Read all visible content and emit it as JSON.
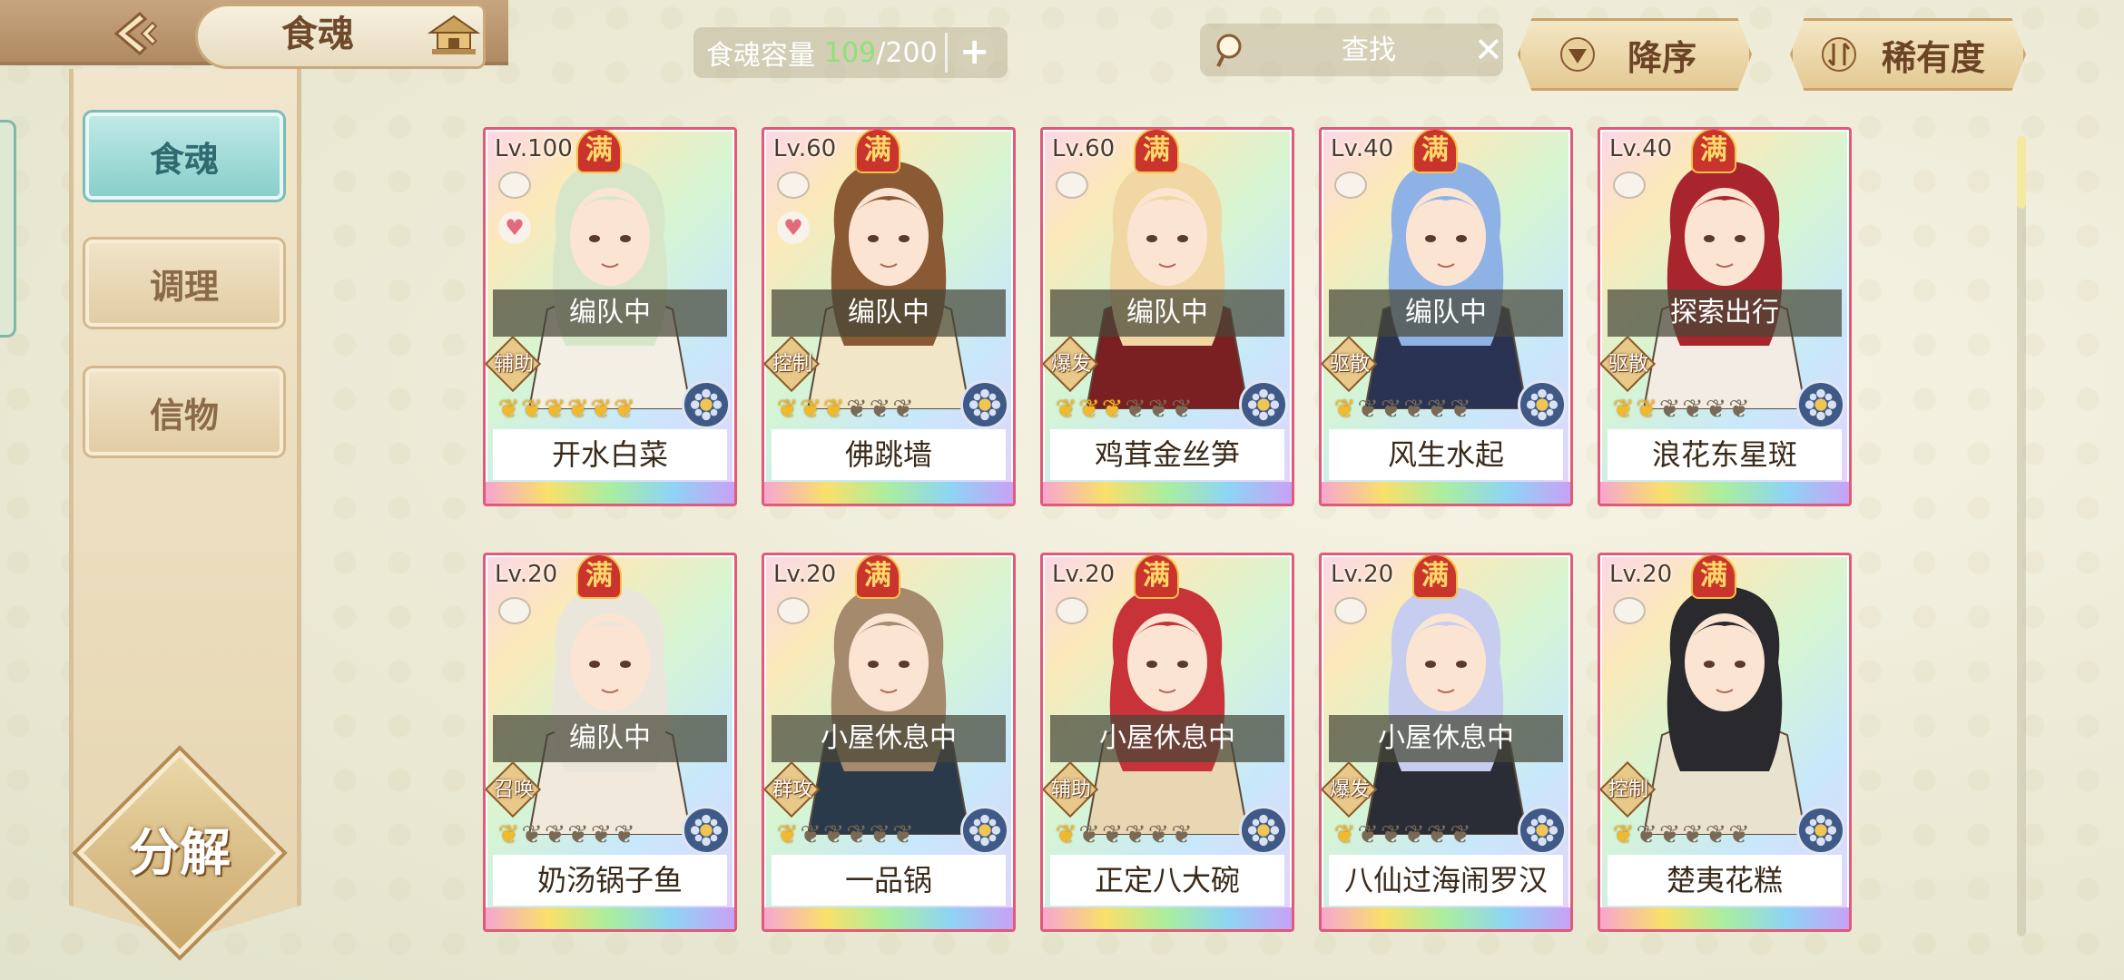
{
  "header": {
    "title": "食魂",
    "capacity_label": "食魂容量",
    "capacity_current": "109",
    "capacity_total": "/200",
    "search_placeholder": "查找",
    "sort_order_label": "降序",
    "sort_by_label": "稀有度"
  },
  "sidebar": {
    "items": [
      {
        "label": "食魂",
        "active": true
      },
      {
        "label": "调理",
        "active": false
      },
      {
        "label": "信物",
        "active": false
      }
    ],
    "decompose_label": "分解"
  },
  "cards": [
    {
      "level": "Lv.100",
      "full": "满",
      "status": "编队中",
      "role": "辅助",
      "stars_on": 6,
      "name": "开水白菜",
      "heart": true,
      "hair": "#d7e6c9",
      "outfit": "#f3efe4"
    },
    {
      "level": "Lv.60",
      "full": "满",
      "status": "编队中",
      "role": "控制",
      "stars_on": 3,
      "name": "佛跳墙",
      "heart": true,
      "hair": "#8a5a34",
      "outfit": "#f1e6c6"
    },
    {
      "level": "Lv.60",
      "full": "满",
      "status": "编队中",
      "role": "爆发",
      "stars_on": 3,
      "name": "鸡茸金丝笋",
      "heart": false,
      "hair": "#f0d7a4",
      "outfit": "#7a1f22"
    },
    {
      "level": "Lv.40",
      "full": "满",
      "status": "编队中",
      "role": "驱散",
      "stars_on": 1,
      "name": "风生水起",
      "heart": false,
      "hair": "#8fb2e6",
      "outfit": "#2a3452"
    },
    {
      "level": "Lv.40",
      "full": "满",
      "status": "探索出行",
      "role": "驱散",
      "stars_on": 2,
      "name": "浪花东星斑",
      "heart": false,
      "hair": "#a8252e",
      "outfit": "#f3ece4"
    },
    {
      "level": "Lv.20",
      "full": "满",
      "status": "编队中",
      "role": "召唤",
      "stars_on": 1,
      "name": "奶汤锅子鱼",
      "heart": false,
      "hair": "#eae6dc",
      "outfit": "#f0e9dc"
    },
    {
      "level": "Lv.20",
      "full": "满",
      "status": "小屋休息中",
      "role": "群攻",
      "stars_on": 1,
      "name": "一品锅",
      "heart": false,
      "hair": "#a58a6e",
      "outfit": "#2b3a4a"
    },
    {
      "level": "Lv.20",
      "full": "满",
      "status": "小屋休息中",
      "role": "辅助",
      "stars_on": 1,
      "name": "正定八大碗",
      "heart": false,
      "hair": "#c8333a",
      "outfit": "#e9d6b2"
    },
    {
      "level": "Lv.20",
      "full": "满",
      "status": "小屋休息中",
      "role": "爆发",
      "stars_on": 1,
      "name": "八仙过海闹罗汉",
      "heart": false,
      "hair": "#c6cdee",
      "outfit": "#2a2c36"
    },
    {
      "level": "Lv.20",
      "full": "满",
      "status": "",
      "role": "控制",
      "stars_on": 1,
      "name": "楚夷花糕",
      "heart": false,
      "hair": "#2a2a2e",
      "outfit": "#e9e2cf"
    }
  ],
  "colors": {
    "accent_gold": "#e4c993",
    "active_tab": "#88cfcb",
    "capacity_green": "#8ee27a"
  }
}
